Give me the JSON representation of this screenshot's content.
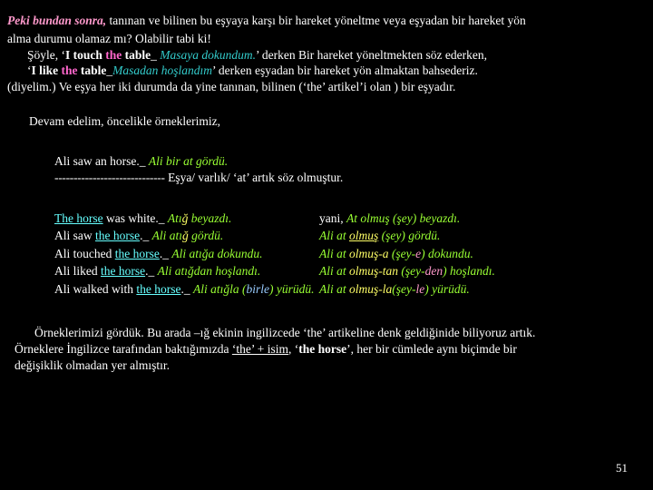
{
  "slide": {
    "page_number": "51",
    "intro": {
      "l1_a": "Peki bundan sonra,",
      "l1_b": " tanınan ve bilinen bu eşyaya karşı bir hareket yöneltme veya eşyadan bir hareket yön",
      "l2": "alma durumu olamaz mı? Olabilir tabi ki!",
      "l3_a": "Şöyle, ‘",
      "l3_b": "I touch ",
      "l3_c": "the ",
      "l3_d": "table",
      "l3_e": "_ ",
      "l3_f": "Masaya dokundum.",
      "l3_g": "’ derken Bir hareket yöneltmekten söz ederken,",
      "l4_a": "‘",
      "l4_b": "I like ",
      "l4_c": "the ",
      "l4_d": "table",
      "l4_e": "_",
      "l4_f": "Masadan hoşlandım",
      "l4_g": "’ derken eşyadan bir hareket yön almaktan bahsederiz.",
      "l5": "(diyelim.) Ve eşya her iki durumda da yine tanınan, bilinen (‘the’ artikel’i olan ) bir eşyadır."
    },
    "devam": "Devam edelim,  öncelikle örneklerimiz,",
    "example": {
      "l1_a": "Ali saw an horse._ ",
      "l1_b": "Ali bir at gördü.",
      "l2_dashes": "-----------------------------",
      "l2_text": " Eşya/ varlık/ ‘at’ artık  söz olmuştur."
    },
    "table": {
      "rows": [
        {
          "left": [
            {
              "t": "The horse",
              "c": "cyan-underline"
            },
            {
              "t": " was white._ ",
              "c": "white"
            },
            {
              "t": "Atı",
              "c": "green-italic"
            },
            {
              "t": "ğ",
              "c": "yellow-italic"
            },
            {
              "t": " beyazdı.",
              "c": "green-italic"
            }
          ],
          "right": [
            {
              "t": "yani,  ",
              "c": "white"
            },
            {
              "t": "At olmuş (şey) beyazdı.",
              "c": "green-italic"
            }
          ]
        },
        {
          "left": [
            {
              "t": "Ali saw ",
              "c": "white"
            },
            {
              "t": "the horse",
              "c": "cyan-underline"
            },
            {
              "t": "._ ",
              "c": "white"
            },
            {
              "t": "Ali ",
              "c": "green-italic"
            },
            {
              "t": "atı",
              "c": "green-italic"
            },
            {
              "t": "ğ",
              "c": "yellow-italic"
            },
            {
              "t": " gördü.",
              "c": "green-italic"
            }
          ],
          "right": [
            {
              "t": "Ali at ",
              "c": "green-italic"
            },
            {
              "t": "olmuş",
              "c": "yellow-italic"
            },
            {
              "t": " (şey) gördü.",
              "c": "green-italic"
            }
          ]
        },
        {
          "left": [
            {
              "t": "Ali touched ",
              "c": "white"
            },
            {
              "t": "the horse",
              "c": "cyan-underline"
            },
            {
              "t": "._ ",
              "c": "white"
            },
            {
              "t": "Ali ",
              "c": "green-italic"
            },
            {
              "t": "atığa",
              "c": "green-italic"
            },
            {
              "t": " dokundu.",
              "c": "green-italic"
            }
          ],
          "right": [
            {
              "t": "Ali at ",
              "c": "green-italic"
            },
            {
              "t": "olmuş-a",
              "c": "yellow-italic"
            },
            {
              "t": " (şey-",
              "c": "green-italic"
            },
            {
              "t": "e",
              "c": "pink-italic"
            },
            {
              "t": ") dokundu.",
              "c": "green-italic"
            }
          ]
        },
        {
          "left": [
            {
              "t": "Ali liked ",
              "c": "white"
            },
            {
              "t": "the horse",
              "c": "cyan-underline"
            },
            {
              "t": "._ ",
              "c": "white"
            },
            {
              "t": "Ali ",
              "c": "green-italic"
            },
            {
              "t": "atığdan",
              "c": "green-italic"
            },
            {
              "t": " hoşlandı.",
              "c": "green-italic"
            }
          ],
          "right": [
            {
              "t": "Ali at ",
              "c": "green-italic"
            },
            {
              "t": "olmuş-tan",
              "c": "yellow-italic"
            },
            {
              "t": " (şey-",
              "c": "green-italic"
            },
            {
              "t": "den",
              "c": "pink-italic"
            },
            {
              "t": ") hoşlandı.",
              "c": "green-italic"
            }
          ]
        },
        {
          "left": [
            {
              "t": "Ali walked with ",
              "c": "white"
            },
            {
              "t": "the horse",
              "c": "cyan-underline"
            },
            {
              "t": "._ ",
              "c": "white"
            },
            {
              "t": "Ali  ",
              "c": "green-italic"
            },
            {
              "t": "atığla",
              "c": "green-italic"
            },
            {
              "t": " (",
              "c": "green-italic"
            },
            {
              "t": "birle",
              "c": "lightblue-italic"
            },
            {
              "t": ") yürüdü.",
              "c": "green-italic"
            }
          ],
          "right": [
            {
              "t": "Ali at ",
              "c": "green-italic"
            },
            {
              "t": "olmuş-la",
              "c": "yellow-italic"
            },
            {
              "t": "(şey-",
              "c": "green-italic"
            },
            {
              "t": "le",
              "c": "pink-italic"
            },
            {
              "t": ") yürüdü.",
              "c": "green-italic"
            }
          ]
        }
      ]
    },
    "tail": {
      "l1": "Örneklerimizi gördük. Bu arada –ığ ekinin ingilizcede ‘the’ artikeline denk geldiğinide biliyoruz artık.",
      "l2_a": "Örneklere İngilizce tarafından baktığımızda ",
      "l2_b": "‘the’ + isim",
      "l2_c": ", ‘",
      "l2_d": "the horse",
      "l2_e": "’, her bir cümlede aynı biçimde bir",
      "l3": "değişiklik olmadan yer almıştır."
    }
  }
}
